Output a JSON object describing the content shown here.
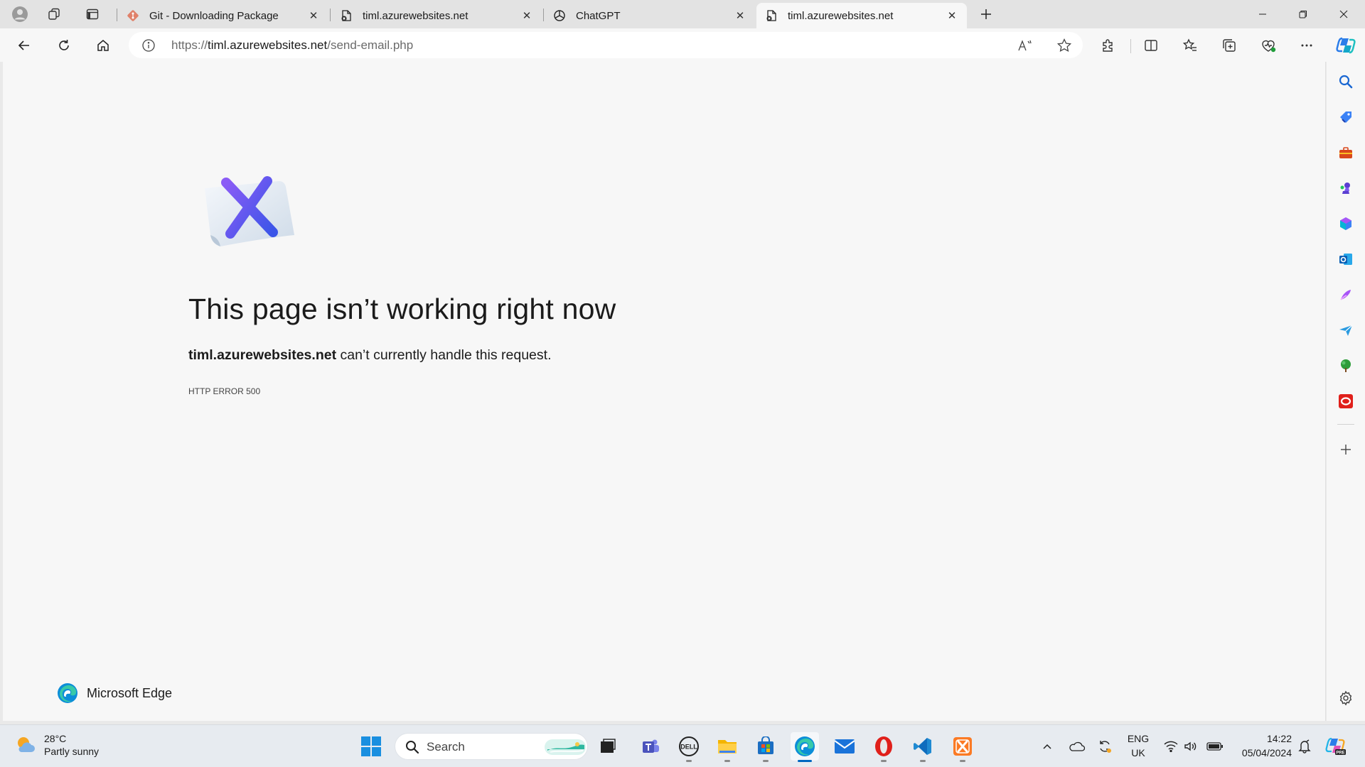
{
  "browser": {
    "tabs": [
      {
        "title": "Git - Downloading Package",
        "icon": "git-icon"
      },
      {
        "title": "timl.azurewebsites.net",
        "icon": "broken-page-icon"
      },
      {
        "title": "ChatGPT",
        "icon": "chatgpt-icon"
      },
      {
        "title": "timl.azurewebsites.net",
        "icon": "broken-page-icon"
      }
    ],
    "url_prefix": "https://",
    "url_host": "timl.azurewebsites.net",
    "url_path": "/send-email.php"
  },
  "error": {
    "title": "This page isn’t working right now",
    "host": "timl.azurewebsites.net",
    "message": " can’t currently handle this request.",
    "code": "HTTP ERROR 500"
  },
  "footer": {
    "brand": "Microsoft Edge"
  },
  "taskbar": {
    "weather_temp": "28°C",
    "weather_desc": "Partly sunny",
    "search_label": "Search",
    "lang_top": "ENG",
    "lang_bottom": "UK",
    "time": "14:22",
    "date": "05/04/2024"
  },
  "colors": {
    "accent": "#0067c0",
    "error_x": "#5b4cf0",
    "page_bg": "#f7f7f7"
  }
}
